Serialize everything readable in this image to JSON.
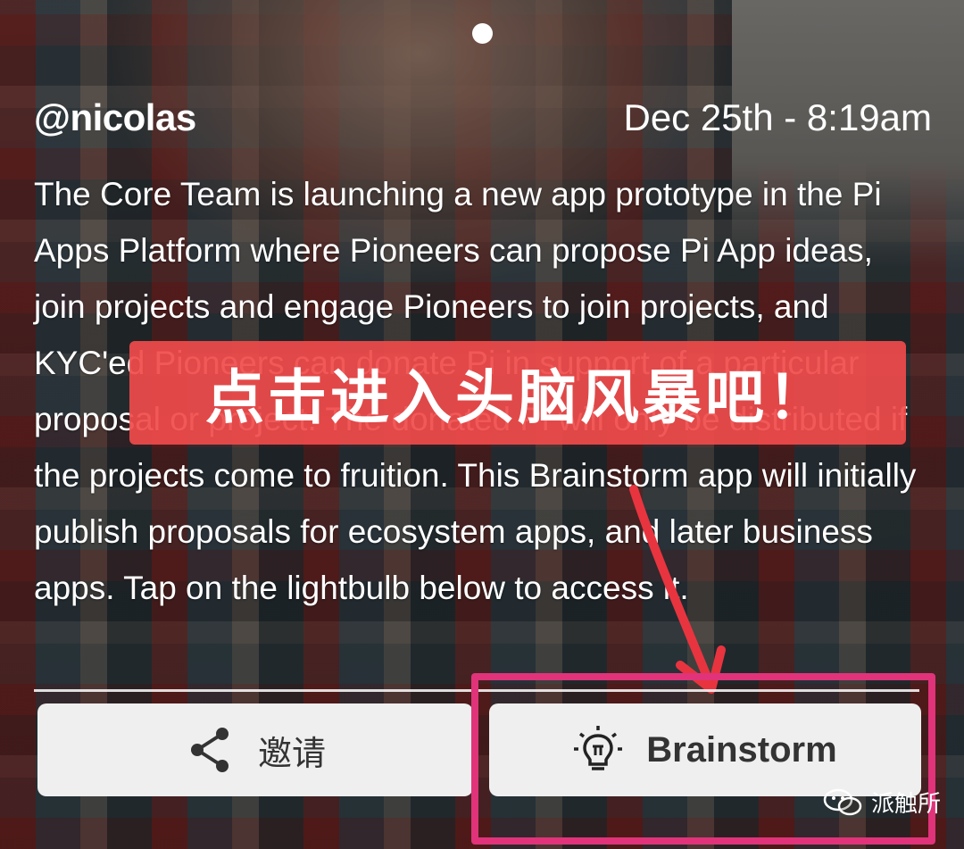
{
  "post": {
    "username": "@nicolas",
    "timestamp": "Dec 25th - 8:19am",
    "message": "The Core Team is launching a new app prototype in the Pi Apps Platform where Pioneers can propose Pi App ideas, join projects and engage Pioneers to join projects, and KYC'ed Pioneers can donate Pi in support of a particular proposal or project. The donated Pi will only be distributed if the projects come to fruition. This Brainstorm app will initially publish proposals for ecosystem apps, and later business apps. Tap on the lightbulb below to access it."
  },
  "overlay": {
    "banner_text": "点击进入头脑风暴吧！",
    "banner_color": "#f04b4b",
    "highlight_color": "#e0337a"
  },
  "actions": {
    "invite_label": "邀请",
    "invite_icon": "share-icon",
    "brainstorm_label": "Brainstorm",
    "brainstorm_icon": "lightbulb-pi-icon"
  },
  "watermark": {
    "text": "派触所",
    "icon": "wechat-icon"
  }
}
